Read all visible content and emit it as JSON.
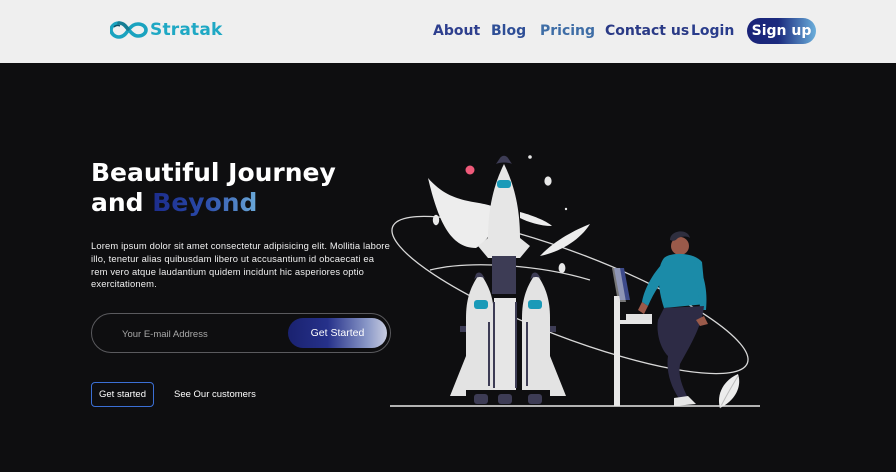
{
  "brand": {
    "name": "Stratak",
    "icon": "infinity-logo-icon"
  },
  "nav": {
    "about": "About",
    "blog": "Blog",
    "pricing": "Pricing",
    "contact": "Contact us",
    "login": "Login",
    "signup": "Sign up"
  },
  "hero": {
    "title_line1": "Beautiful Journey",
    "title_line2_prefix": "and ",
    "title_line2_accent": "Beyond",
    "description": "Lorem ipsum dolor sit amet consectetur adipisicing elit. Mollitia labore illo, tenetur alias quibusdam libero ut accusantium id obcaecati ea rem vero atque laudantium quidem incidunt hic asperiores optio exercitationem."
  },
  "form": {
    "email_placeholder": "Your E-mail Address",
    "email_value": "",
    "submit_label": "Get Started"
  },
  "actions": {
    "get_started_label": "Get started",
    "customers_label": "See Our customers"
  },
  "illustration": {
    "icon": "rocket-launch-illustration"
  },
  "colors": {
    "background": "#0e0e10",
    "navbar": "#efefef",
    "brand": "#1fa8c4",
    "nav_link": "#2e3f8e",
    "accent_dark": "#1a2378",
    "accent_light": "#6aaedb",
    "cta_border": "#3b6fd4",
    "person_shirt": "#1b8ba8"
  }
}
